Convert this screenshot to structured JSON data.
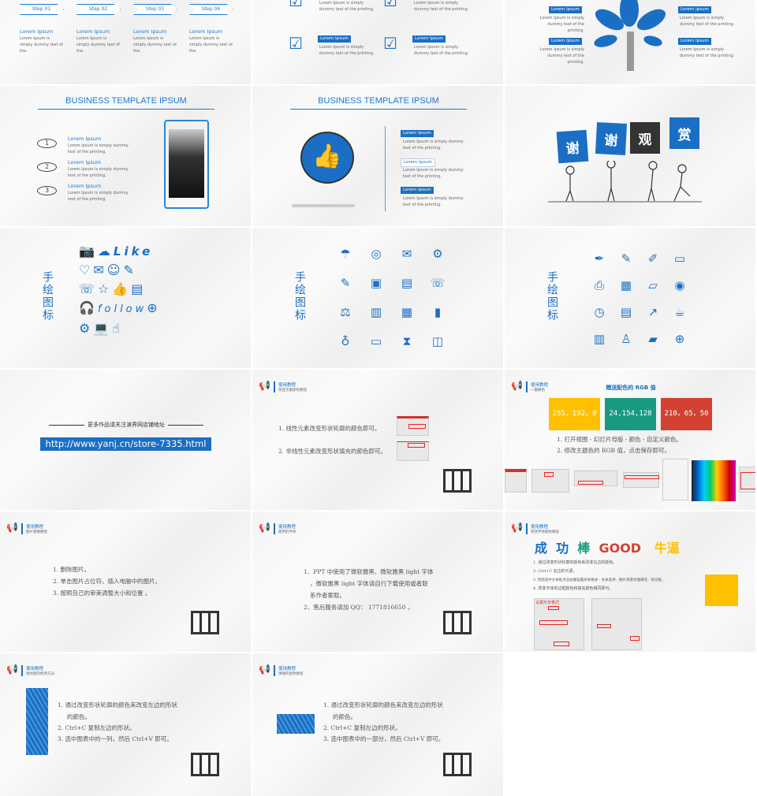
{
  "slides": {
    "steps": {
      "items": [
        {
          "step": "Step 01",
          "title": "Lorem Ipsum",
          "body": "Lorem Ipsum is simply dummy text of the."
        },
        {
          "step": "Step 02",
          "title": "Lorem Ipsum",
          "body": "Lorem Ipsum is simply dummy text of the."
        },
        {
          "step": "Step 03",
          "title": "Lorem Ipsum",
          "body": "Lorem Ipsum is simply dummy text of the."
        },
        {
          "step": "Step 04",
          "title": "Lorem Ipsum",
          "body": "Lorem Ipsum is simply dummy text of the."
        }
      ]
    },
    "checks": {
      "items": [
        {
          "title": "",
          "body": "Lorem Ipsum is simply dummy text of the printing."
        },
        {
          "title": "",
          "body": "Lorem Ipsum is simply dummy text of the printing."
        },
        {
          "title": "Lorem Ipsum",
          "body": "Lorem Ipsum is simply dummy text of the printing."
        },
        {
          "title": "Lorem Ipsum",
          "body": "Lorem Ipsum is simply dummy text of the printing."
        }
      ]
    },
    "tree": {
      "items": [
        {
          "title": "Lorem Ipsum",
          "body": "Lorem Ipsum is simply dummy text of the printing."
        },
        {
          "title": "Lorem Ipsum",
          "body": "Lorem Ipsum is simply dummy text of the printing."
        },
        {
          "title": "Lorem Ipsum",
          "body": "Lorem Ipsum is simply dummy text of the printing."
        },
        {
          "title": "Lorem Ipsum",
          "body": "Lorem Ipsum is simply dummy text of the printing."
        }
      ]
    },
    "numbered": {
      "title": "BUSINESS TEMPLATE IPSUM",
      "items": [
        {
          "num": "1",
          "title": "Lorem Ipsum",
          "body": "Lorem Ipsum is simply dummy text of the printing."
        },
        {
          "num": "2",
          "title": "Lorem Ipsum",
          "body": "Lorem Ipsum is simply dummy text of the printing."
        },
        {
          "num": "3",
          "title": "Lorem Ipsum",
          "body": "Lorem Ipsum is simply dummy text of the printing."
        }
      ]
    },
    "thumbs": {
      "title": "BUSINESS TEMPLATE IPSUM",
      "items": [
        {
          "title": "Lorem Ipsum",
          "body": "Lorem Ipsum is simply dummy text of the printing."
        },
        {
          "title": "Lorem Ipsum",
          "body": "Lorem Ipsum is simply dummy text of the printing."
        },
        {
          "title": "Lorem Ipsum",
          "body": "Lorem Ipsum is simply dummy text of the printing."
        }
      ]
    },
    "thanks": {
      "signs": [
        "谢",
        "谢",
        "观",
        "赏"
      ]
    },
    "icons1": {
      "label": "手绘图标",
      "doodle_text": "Like",
      "follow_text": "follow"
    },
    "icons2": {
      "label": "手绘图标",
      "icons": [
        "umbrella",
        "globe",
        "mail",
        "gear",
        "pencil",
        "disk",
        "document",
        "phone",
        "scale",
        "abacus",
        "newspaper",
        "book",
        "bulb",
        "monitor",
        "hourglass",
        "bag"
      ]
    },
    "icons3": {
      "label": "手绘图标",
      "icons": [
        "feather",
        "pen",
        "marker",
        "laptop",
        "printer",
        "calendar",
        "scanner",
        "cd",
        "clock",
        "chart",
        "trend",
        "cup",
        "newspaper",
        "chair",
        "folder",
        "globe"
      ]
    },
    "store": {
      "caption": "更多作品请关注演界网店铺地址",
      "url": "http://www.yanj.cn/store-7335.html"
    },
    "tut_shape": {
      "title": "使用教程",
      "subtitle": "改变元素颜色教程",
      "lines": [
        "1. 线性元素改变形状轮廓的颜色即可。",
        "2. 非线性元素改变形状填充的颜色即可。"
      ]
    },
    "tut_rgb": {
      "title": "使用教程",
      "subtitle": "一键换色",
      "heading": "赠送配色的 RGB 值",
      "colors": [
        {
          "label": "255，192，0",
          "hex": "#ffc000"
        },
        {
          "label": "24,154,128",
          "hex": "#189a80"
        },
        {
          "label": "210，65，50",
          "hex": "#d24132"
        }
      ],
      "lines": [
        "1. 打开视图 - 幻灯片母版 - 颜色 - 自定义颜色。",
        "2. 修改主题色的 RGB 值，点击保存即可。"
      ]
    },
    "tut_image": {
      "title": "使用教程",
      "subtitle": "图片替换教程",
      "lines": [
        "1. 删除图片。",
        "2. 单击图片占位符，插入电脑中的图片。",
        "3. 按照自己的审美调整大小和位置 。"
      ]
    },
    "tut_font": {
      "title": "使用教程",
      "subtitle": "使用的字体",
      "lines": [
        "1、PPT 中使用了微软雅黑、微软雅黑 light 字体",
        "，微软雅黑 light 字体请自行下载使用或者联",
        "系作者索取。",
        "2、售后服务请加 QQ： 1771816650 。"
      ]
    },
    "tut_textcolor": {
      "title": "使用教程",
      "subtitle": "修改字体颜色教程",
      "words": [
        {
          "text": "成",
          "color": "#1a6fc4"
        },
        {
          "text": "功",
          "color": "#1a6fc4"
        },
        {
          "text": "棒",
          "color": "#189a80"
        },
        {
          "text": "GOOD",
          "color": "#d24132"
        },
        {
          "text": "牛逼",
          "color": "#ffc000"
        }
      ],
      "lines": [
        "1. 通过改变形状轮廓的颜色来改变右边的颜色。",
        "2. Ctrl+C 右边的元素。",
        "3. 然后选中文本框点击右键设置形状格式 - 文本选项 - 图片或者纹理填充 - 剪切板。",
        "4. 改变字体的边框颜色和填充颜色相同即可。"
      ],
      "panel_title": "设置形状格式"
    },
    "tut_bar": {
      "title": "使用教程",
      "subtitle": "柱状图的修改方法",
      "lines": [
        "1. 通过改变形状轮廓的颜色来改变左边的形状",
        "的颜色。",
        "2. Ctrl+C 复制左边的形状。",
        "3. 选中图表中的一列，然后 Ctrl+V 即可。"
      ]
    },
    "tut_pie": {
      "title": "使用教程",
      "subtitle": "饼图的修改教程",
      "lines": [
        "1. 通过改变形状轮廓的颜色来改变左边的形状",
        "的颜色。",
        "2. Ctrl+C 复制左边的形状。",
        "3. 选中图表中的一部分，然后 Ctrl+V 即可。"
      ]
    }
  },
  "colors": {
    "accent": "#1a6fc4",
    "dark": "#333333"
  }
}
